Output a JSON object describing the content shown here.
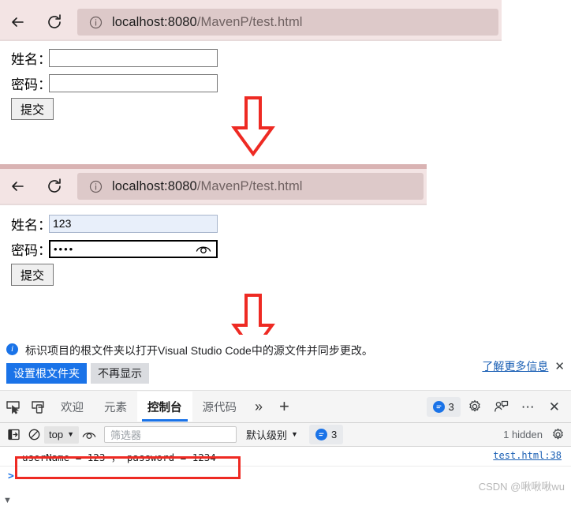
{
  "browser_shots": [
    {
      "id": "shot-one",
      "back_icon": "back-arrow-icon",
      "reload_icon": "reload-icon",
      "info_icon": "info-circle-icon",
      "url_host": "localhost:8080",
      "url_path": "/MavenP/test.html"
    },
    {
      "id": "shot-two",
      "back_icon": "back-arrow-icon",
      "reload_icon": "reload-icon",
      "info_icon": "info-circle-icon",
      "url_host": "localhost:8080",
      "url_path": "/MavenP/test.html"
    }
  ],
  "form_empty": {
    "name_label": "姓名：",
    "name_value": "",
    "password_label": "密码：",
    "password_value": "",
    "submit_label": "提交"
  },
  "form_filled": {
    "name_label": "姓名：",
    "name_value": "123",
    "password_label": "密码：",
    "password_masked": "••••",
    "password_reveal_icon": "eye-icon",
    "submit_label": "提交"
  },
  "arrows": {
    "color": "#ee2a23",
    "direction": "down"
  },
  "devtools": {
    "infobar": {
      "icon": "info-icon",
      "message": "标识项目的根文件夹以打开Visual Studio Code中的源文件并同步更改。",
      "primary_button": "设置根文件夹",
      "secondary_button": "不再显示",
      "learn_more": "了解更多信息",
      "close": "✕",
      "primary_color": "#1a73e8"
    },
    "tabstrip": {
      "inspect_icon": "inspect-element-icon",
      "device_icon": "device-toolbar-icon",
      "tabs": [
        {
          "label": "欢迎",
          "active": false
        },
        {
          "label": "元素",
          "active": false
        },
        {
          "label": "控制台",
          "active": true
        },
        {
          "label": "源代码",
          "active": false
        }
      ],
      "more_tabs": "»",
      "add_tab": "+",
      "message_count": "3",
      "settings_icon": "gear-icon",
      "feedback_icon": "feedback-icon",
      "more_options": "⋯",
      "close_icon": "✕",
      "active_tab_underline_color": "#1a73e8"
    },
    "console_toolbar": {
      "sidebar_icon": "console-sidebar-icon",
      "clear_icon": "clear-console-icon",
      "context_selector": "top",
      "eye_icon": "live-expression-icon",
      "filter_placeholder": "筛选器",
      "level_selector": "默认级别",
      "message_count": "3",
      "hidden_text": "1 hidden",
      "settings_icon": "gear-icon"
    },
    "console_log": {
      "message": "userName = 123 ， password = 1234",
      "source": "test.html:38",
      "highlight_color": "#ee2a23",
      "prompt": ">"
    }
  },
  "watermark": "CSDN @啾啾啾wu",
  "bottom_scroll_icon": "▼"
}
